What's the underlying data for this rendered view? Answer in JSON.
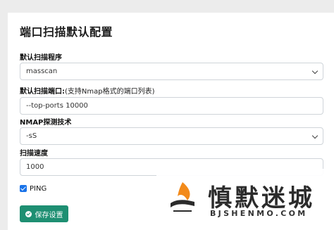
{
  "page": {
    "title": "端口扫描默认配置"
  },
  "fields": {
    "program": {
      "label": "默认扫描程序",
      "value": "masscan"
    },
    "ports": {
      "label": "默认扫描端口:",
      "hint": "(支持Nmap格式的端口列表)",
      "value": "--top-ports 10000"
    },
    "nmap_tech": {
      "label": "NMAP探测技术",
      "value": "-sS"
    },
    "speed": {
      "label": "扫描速度",
      "value": "1000"
    }
  },
  "ping": {
    "label": "PING",
    "checked": true
  },
  "save_button": {
    "label": "保存设置"
  },
  "watermark": {
    "text": "慎默迷城",
    "subtext": "BJSHENMO.COM"
  },
  "colors": {
    "accent": "#1e8f72",
    "checkbox": "#1a73e8",
    "logo_orange": "#f28a1b"
  }
}
